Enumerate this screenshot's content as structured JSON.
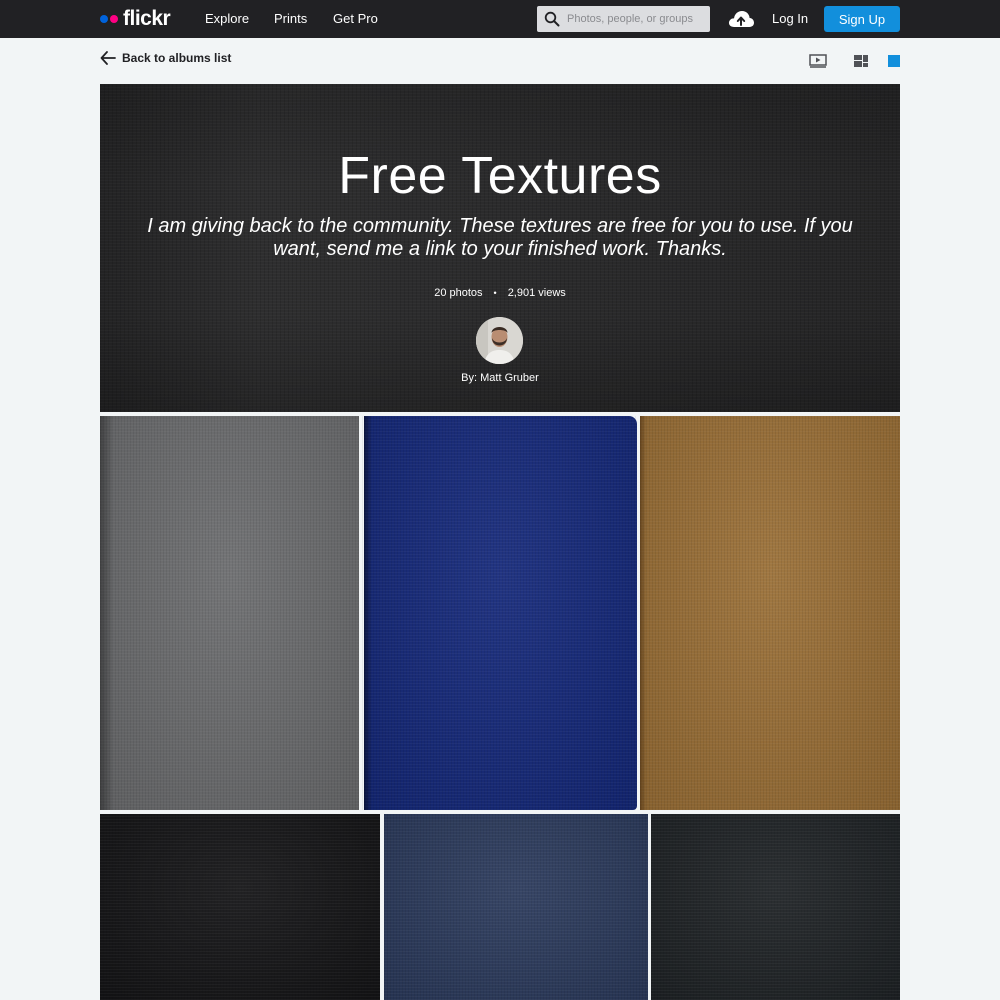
{
  "nav": {
    "logo_text": "flickr",
    "links": [
      "Explore",
      "Prints",
      "Get Pro"
    ],
    "search_placeholder": "Photos, people, or groups",
    "upload_icon": "cloud-upload-icon",
    "login_label": "Log In",
    "signup_label": "Sign Up",
    "colors": {
      "bar": "#212124",
      "signup": "#128fdc",
      "dot_blue": "#0063dc",
      "dot_pink": "#ff0084"
    }
  },
  "subheader": {
    "back_label": "Back to albums list",
    "view_icons": [
      "slideshow-icon",
      "grid-view-icon",
      "single-view-icon"
    ],
    "active_view_color": "#128fdc"
  },
  "album": {
    "title": "Free Textures",
    "description": "I am giving back to the community. These textures are free for you to use. If you want, send me a link to your finished work. Thanks.",
    "photo_count": "20 photos",
    "separator": "•",
    "views": "2,901 views",
    "author": "By: Matt Gruber"
  },
  "photos": [
    {
      "color": "#6b6c6e"
    },
    {
      "color": "#14287a"
    },
    {
      "color": "#9a6f36"
    },
    {
      "color": "#141416"
    },
    {
      "color": "#2b3a5c"
    },
    {
      "color": "#1e2225"
    }
  ]
}
